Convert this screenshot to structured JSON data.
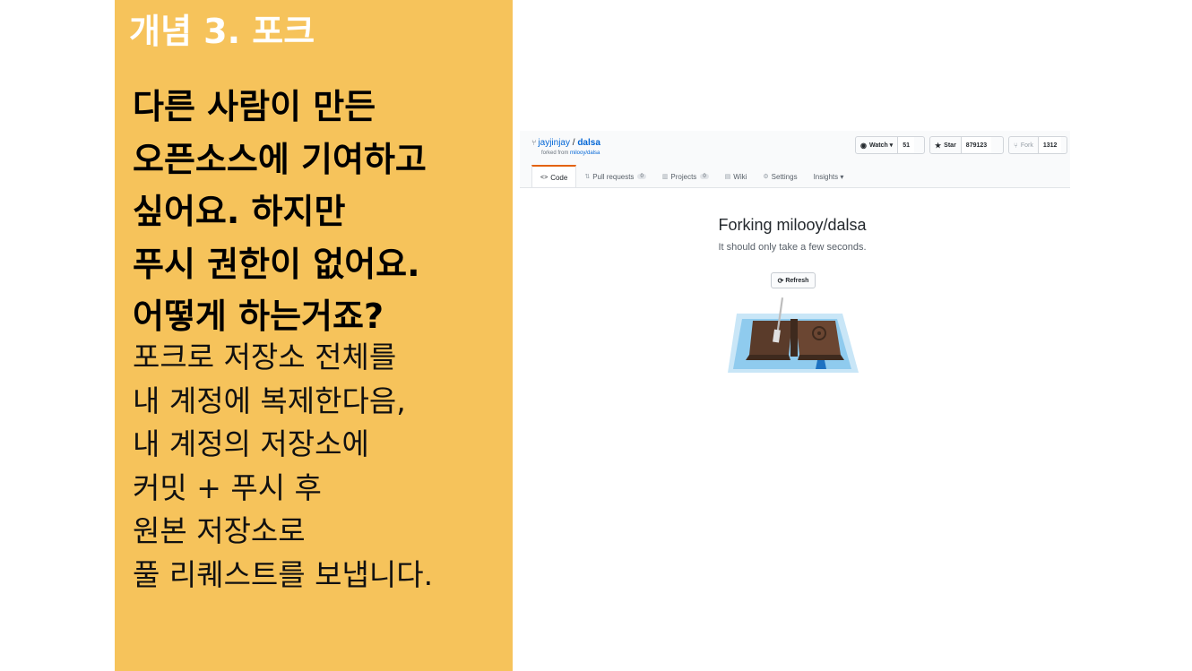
{
  "slide": {
    "concept_title": "개념 3. 포크",
    "question_lines": [
      "다른 사람이 만든",
      "오픈소스에 기여하고",
      "싶어요. 하지만",
      "푸시 권한이 없어요.",
      "어떻게 하는거죠?"
    ],
    "answer_lines": [
      "포크로 저장소 전체를",
      "내 계정에 복제한다음,",
      "내 계정의 저장소에",
      "커밋 + 푸시 후",
      "원본 저장소로",
      "풀 리퀘스트를 보냅니다."
    ],
    "accent_color": "#f6c35b"
  },
  "github": {
    "owner": "jayjinjay",
    "separator": "/",
    "repo": "dalsa",
    "forked_prefix": "forked from",
    "forked_source": "milooy/dalsa",
    "watch": {
      "label": "Watch ▾",
      "count": "51",
      "icon": "eye-icon"
    },
    "star": {
      "label": "Star",
      "count": "879123",
      "icon": "star-icon"
    },
    "fork": {
      "label": "Fork",
      "count": "1312",
      "icon": "fork-icon"
    },
    "tabs": [
      {
        "label": "Code",
        "icon": "code-icon",
        "active": true
      },
      {
        "label": "Pull requests",
        "badge": "0",
        "icon": "pull-request-icon"
      },
      {
        "label": "Projects",
        "badge": "0",
        "icon": "projects-icon"
      },
      {
        "label": "Wiki",
        "icon": "wiki-icon"
      },
      {
        "label": "Settings",
        "icon": "gear-icon"
      },
      {
        "label": "Insights ▾"
      }
    ],
    "forking_title": "Forking milooy/dalsa",
    "forking_subtitle": "It should only take a few seconds.",
    "refresh_label": "Refresh",
    "link_color": "#0366d6",
    "active_tab_color": "#e36209"
  }
}
